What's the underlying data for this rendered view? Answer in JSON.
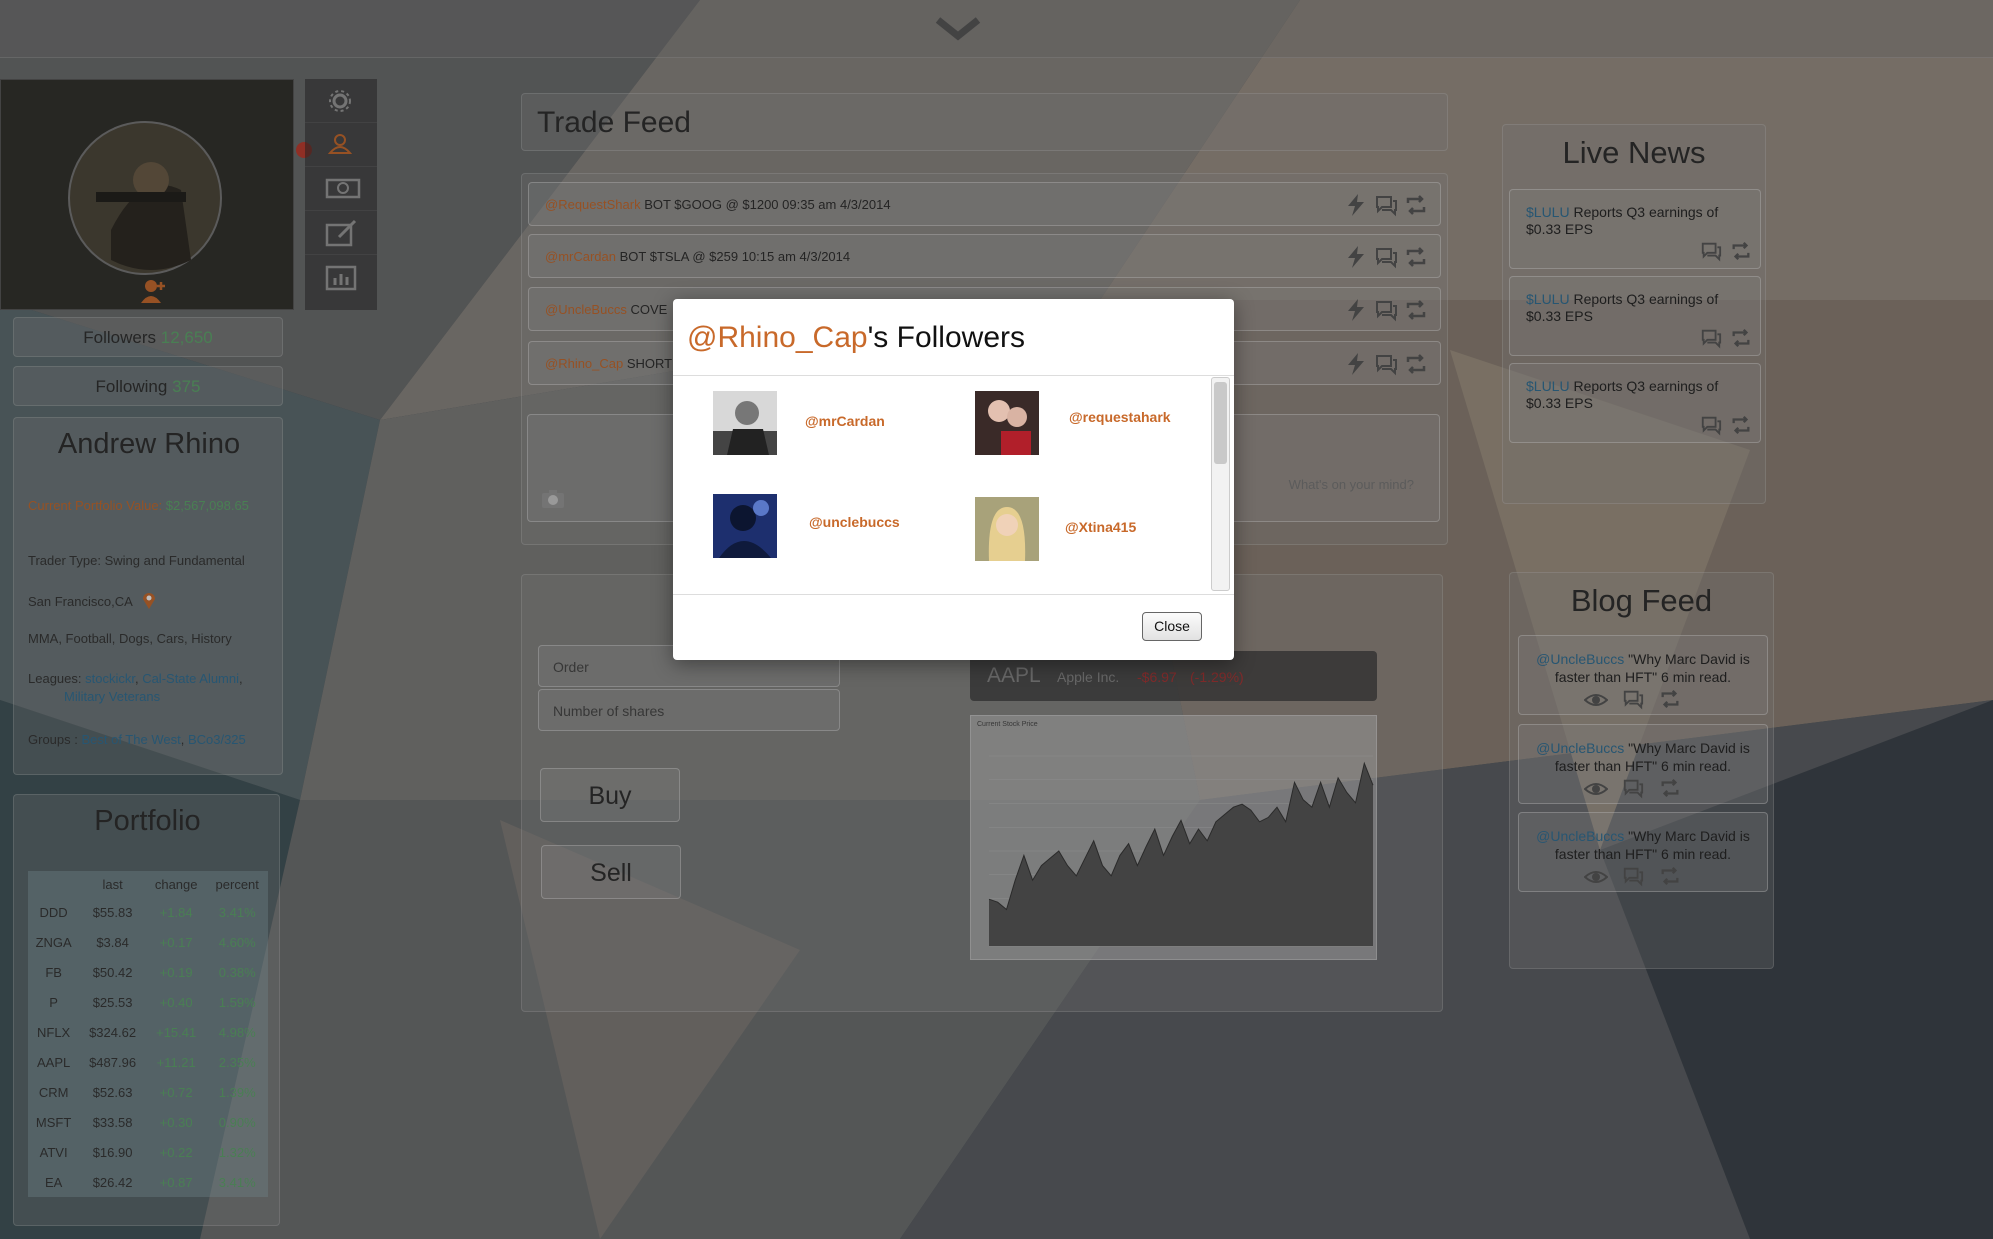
{
  "profile": {
    "followers_label": "Followers",
    "followers_count": "12,650",
    "following_label": "Following",
    "following_count": "375",
    "name": "Andrew Rhino",
    "portfolio_value_label": "Current Portfolio Value: ",
    "portfolio_value": "$2,567,098.65",
    "trader_type": "Trader Type: Swing and Fundamental",
    "location": "San Francisco,CA",
    "interests": "MMA, Football, Dogs, Cars, History",
    "leagues_label": "Leagues: ",
    "league_1": "stockickr",
    "league_2": "Cal-State Alumni",
    "league_3": "Military Veterans",
    "groups_label": "Groups : ",
    "group_1": "Best of The West",
    "group_2": "BCo3/325"
  },
  "portfolio": {
    "title": "Portfolio",
    "headers": [
      "",
      "last",
      "change",
      "percent"
    ],
    "rows": [
      [
        "DDD",
        "$55.83",
        "+1.84",
        "3.41%"
      ],
      [
        "ZNGA",
        "$3.84",
        "+0.17",
        "4.60%"
      ],
      [
        "FB",
        "$50.42",
        "+0.19",
        "0.38%"
      ],
      [
        "P",
        "$25.53",
        "+0.40",
        "1.59%"
      ],
      [
        "NFLX",
        "$324.62",
        "+15.41",
        "4.98%"
      ],
      [
        "AAPL",
        "$487.96",
        "+11.21",
        "2.35%"
      ],
      [
        "CRM",
        "$52.63",
        "+0.72",
        "1.39%"
      ],
      [
        "MSFT",
        "$33.58",
        "+0.30",
        "0.90%"
      ],
      [
        "ATVI",
        "$16.90",
        "+0.22",
        "1.32%"
      ],
      [
        "EA",
        "$26.42",
        "+0.87",
        "3.41%"
      ]
    ]
  },
  "trade_feed": {
    "title": "Trade Feed",
    "items": [
      {
        "user": "@RequestShark",
        "text": " BOT $GOOG @ $1200 09:35 am 4/3/2014"
      },
      {
        "user": "@mrCardan",
        "text": " BOT $TSLA @ $259 10:15 am 4/3/2014"
      },
      {
        "user": "@UncleBuccs",
        "text": " COVE"
      },
      {
        "user": "@Rhino_Cap",
        "text": " SHORT"
      }
    ],
    "post_placeholder": "What's on your mind?"
  },
  "trade_form": {
    "order_placeholder": "Order",
    "shares_placeholder": "Number of shares",
    "buy_label": "Buy",
    "sell_label": "Sell"
  },
  "quote": {
    "symbol": "AAPL",
    "name": "Apple Inc.",
    "change": "-$6.97",
    "percent": "(-1.29%)",
    "chart_legend": "Current Stock Price"
  },
  "live_news": {
    "title": "Live News",
    "items": [
      {
        "ticker": "$LULU",
        "text": " Reports Q3 earnings of $0.33 EPS"
      },
      {
        "ticker": "$LULU",
        "text": " Reports Q3 earnings of $0.33 EPS"
      },
      {
        "ticker": "$LULU",
        "text": " Reports Q3 earnings of $0.33 EPS"
      }
    ]
  },
  "blog_feed": {
    "title": "Blog Feed",
    "items": [
      {
        "user": "@UncleBuccs",
        "text": " \"Why Marc David is faster than HFT\" 6 min read."
      },
      {
        "user": "@UncleBuccs",
        "text": " \"Why Marc David is faster than HFT\" 6 min read."
      },
      {
        "user": "@UncleBuccs",
        "text": " \"Why Marc David is faster than HFT\" 6 min read."
      }
    ]
  },
  "modal": {
    "title_handle": "@Rhino_Cap",
    "title_suffix": "'s Followers",
    "followers": [
      "@mrCardan",
      "@requestahark",
      "@unclebuccs",
      "@Xtina415"
    ],
    "close_label": "Close"
  }
}
